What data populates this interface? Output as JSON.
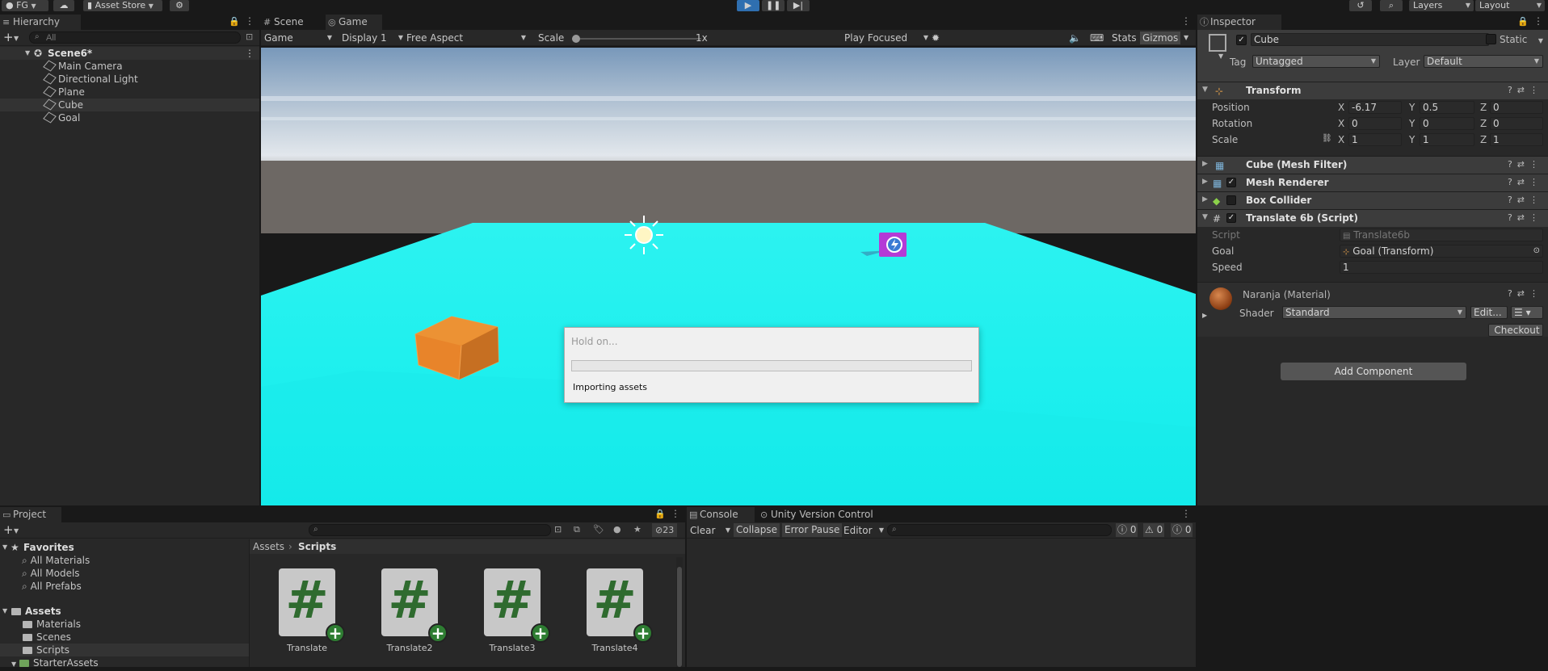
{
  "toolbar": {
    "account": "FG",
    "asset_store": "Asset Store",
    "layers": "Layers",
    "layout": "Layout"
  },
  "hierarchy": {
    "tab": "Hierarchy",
    "search_placeholder": "All",
    "scene": "Scene6*",
    "items": [
      "Main Camera",
      "Directional Light",
      "Plane",
      "Cube",
      "Goal"
    ]
  },
  "viewport": {
    "tabs": [
      "Scene",
      "Game"
    ],
    "game_dropdown": "Game",
    "display": "Display 1",
    "aspect": "Free Aspect",
    "scale_label": "Scale",
    "scale_value": "1x",
    "play_mode": "Play Focused",
    "stats": "Stats",
    "gizmos": "Gizmos"
  },
  "dialog": {
    "title": "Hold on...",
    "message": "Importing assets",
    "progress": 0
  },
  "inspector": {
    "tab": "Inspector",
    "object_name": "Cube",
    "static_label": "Static",
    "tag_label": "Tag",
    "tag_value": "Untagged",
    "layer_label": "Layer",
    "layer_value": "Default",
    "transform": {
      "title": "Transform",
      "position_label": "Position",
      "rotation_label": "Rotation",
      "scale_label": "Scale",
      "position": {
        "x": "-6.17",
        "y": "0.5",
        "z": "0"
      },
      "rotation": {
        "x": "0",
        "y": "0",
        "z": "0"
      },
      "scale": {
        "x": "1",
        "y": "1",
        "z": "1"
      }
    },
    "components": [
      "Cube (Mesh Filter)",
      "Mesh Renderer",
      "Box Collider",
      "Translate 6b (Script)"
    ],
    "script": {
      "script_label": "Script",
      "script_value": "Translate6b",
      "goal_label": "Goal",
      "goal_value": "Goal (Transform)",
      "speed_label": "Speed",
      "speed_value": "1"
    },
    "material": {
      "name": "Naranja (Material)",
      "shader_label": "Shader",
      "shader_value": "Standard",
      "edit": "Edit...",
      "checkout": "Checkout"
    },
    "add_component": "Add Component"
  },
  "project": {
    "tab": "Project",
    "favorites": "Favorites",
    "favorite_items": [
      "All Materials",
      "All Models",
      "All Prefabs"
    ],
    "assets": "Assets",
    "asset_folders": [
      "Materials",
      "Scenes",
      "Scripts",
      "StarterAssets"
    ],
    "breadcrumb_root": "Assets",
    "breadcrumb_current": "Scripts",
    "hidden_count": "23",
    "scripts": [
      "Translate",
      "Translate2",
      "Translate3",
      "Translate4"
    ]
  },
  "console": {
    "tab": "Console",
    "vc_tab": "Unity Version Control",
    "clear": "Clear",
    "collapse": "Collapse",
    "error_pause": "Error Pause",
    "editor": "Editor",
    "log_count": "0",
    "warn_count": "0",
    "error_count": "0"
  },
  "colors": {
    "plane": "#1ff0ef",
    "cube": "#e8842a",
    "goal": "#b43bd6"
  }
}
